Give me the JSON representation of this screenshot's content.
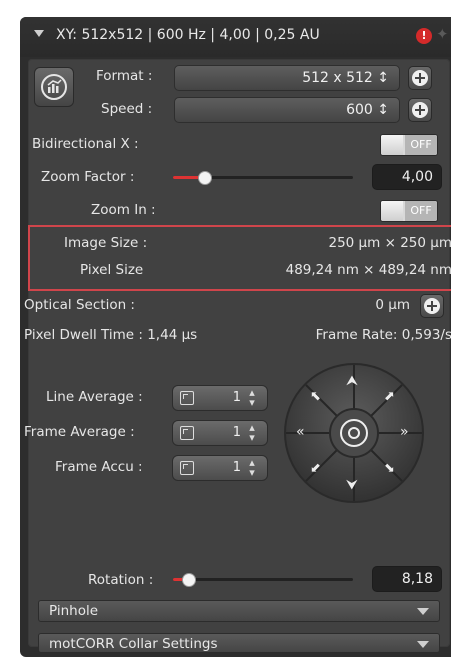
{
  "header": {
    "title": "XY: 512x512 | 600 Hz | 4,00 | 0,25 AU"
  },
  "format": {
    "label": "Format :",
    "value": "512 x 512 ↕"
  },
  "speed": {
    "label": "Speed :",
    "value": "600 ↕"
  },
  "bidirectional": {
    "label": "Bidirectional X :",
    "state": "OFF"
  },
  "zoom_factor": {
    "label": "Zoom Factor :",
    "value": "4,00",
    "level": 0.18
  },
  "zoom_in": {
    "label": "Zoom In :",
    "state": "OFF"
  },
  "image_size": {
    "label": "Image Size :",
    "value": "250 µm × 250 µm"
  },
  "pixel_size": {
    "label": "Pixel Size",
    "value": "489,24 nm × 489,24 nm"
  },
  "optical_section": {
    "label": "Optical Section :",
    "value": "0 µm"
  },
  "pixel_dwell": {
    "text": "Pixel Dwell Time : 1,44 µs"
  },
  "frame_rate": {
    "text": "Frame Rate: 0,593/s"
  },
  "line_average": {
    "label": "Line Average :",
    "value": "1"
  },
  "frame_average": {
    "label": "Frame Average :",
    "value": "1"
  },
  "frame_accu": {
    "label": "Frame Accu :",
    "value": "1"
  },
  "rotation": {
    "label": "Rotation :",
    "value": "8,18",
    "level": 0.09
  },
  "sections": [
    {
      "label": "Pinhole"
    },
    {
      "label": "motCORR Collar Settings"
    }
  ],
  "colors": {
    "accent": "#dd3333",
    "highlight_border": "#d0454b",
    "panel": "#414141"
  }
}
